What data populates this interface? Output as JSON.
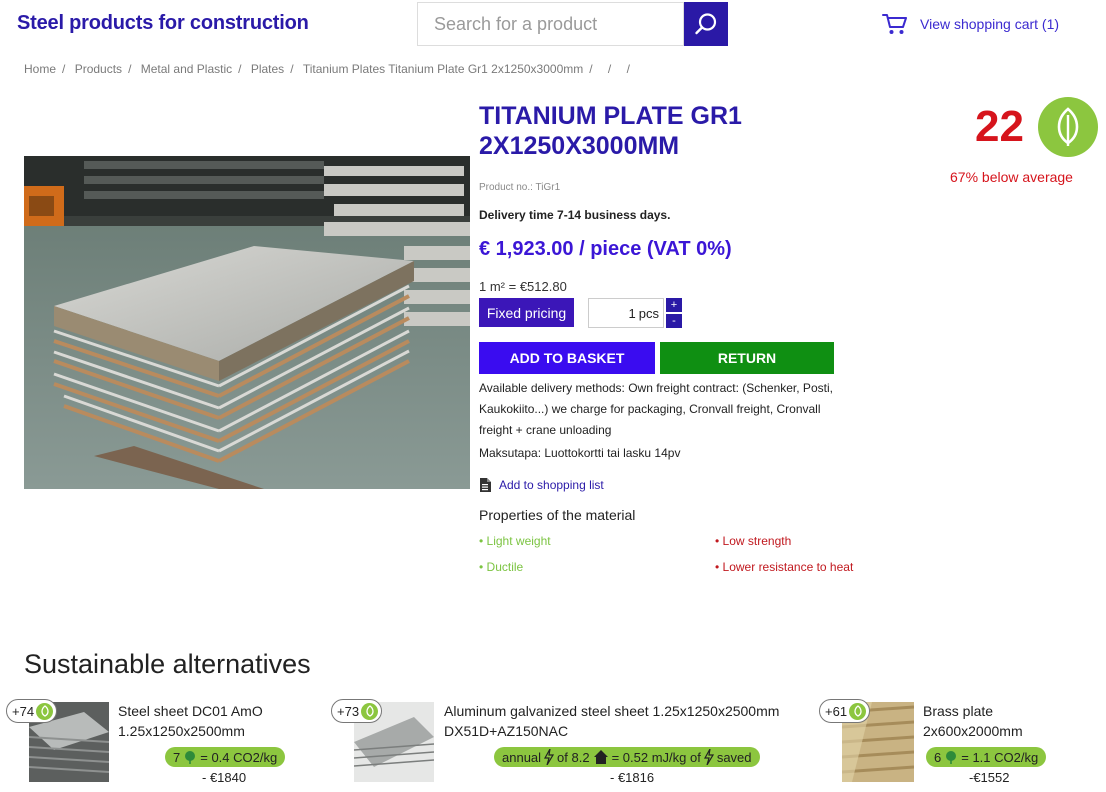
{
  "header": {
    "site_title": "Steel products for construction",
    "search_placeholder": "Search for a product",
    "cart_label": "View shopping cart (1)"
  },
  "breadcrumb": [
    "Home",
    "Products",
    "Metal and Plastic",
    "Plates",
    "Titanium Plates Titanium Plate Gr1 2x1250x3000mm",
    "",
    "",
    ""
  ],
  "product": {
    "title": "TITANIUM PLATE GR1 2X1250X3000MM",
    "product_no": "Product no.: TiGr1",
    "delivery_time": "Delivery time 7-14 business days.",
    "price": "€ 1,923.00 / piece (VAT 0%)",
    "unit_price": "1 m² = €512.80",
    "fixed_pricing_label": "Fixed pricing",
    "quantity": "1",
    "quantity_unit": "pcs",
    "qty_up": "+",
    "qty_down": "-",
    "add_to_basket": "ADD TO BASKET",
    "return_label": "RETURN",
    "delivery_methods": "Available delivery methods: Own freight contract: (Schenker, Posti, Kaukokiito...) we charge for packaging, Cronvall freight, Cronvall freight + crane unloading",
    "payment": "Maksutapa: Luottokortti tai lasku 14pv",
    "shopping_list": "Add to shopping list",
    "properties_title": "Properties of the material",
    "properties_good": [
      "Light weight",
      "Ductile"
    ],
    "properties_bad": [
      "Low strength",
      "Lower resistance to heat"
    ]
  },
  "sustainability": {
    "score": "22",
    "below_average": "67% below average"
  },
  "alternatives": {
    "heading": "Sustainable alternatives",
    "items": [
      {
        "badge": "+74",
        "name_line1": "Steel sheet DC01 AmO",
        "name_line2": "1.25x1250x2500mm",
        "pill_pre": "7",
        "pill_post": "= 0.4 CO2/kg",
        "price": "- €1840"
      },
      {
        "badge": "+73",
        "name_line1": "Aluminum galvanized steel sheet 1.25x1250x2500mm",
        "name_line2": "DX51D+AZ150NAC",
        "pill_pre": "annual",
        "pill_mid": "of 8.2",
        "pill_post": "= 0.52 mJ/kg of",
        "pill_end": "saved",
        "price": "- €1816"
      },
      {
        "badge": "+61",
        "name_line1": "Brass plate",
        "name_line2": "2x600x2000mm",
        "pill_pre": "6",
        "pill_post": "= 1.1 CO2/kg",
        "price": "-€1552"
      }
    ]
  },
  "colors": {
    "brand": "#2a1aa8",
    "accent": "#3a0cf0",
    "return": "#0f8f12",
    "eco_green": "#8cc63f",
    "score_red": "#d6141c"
  }
}
